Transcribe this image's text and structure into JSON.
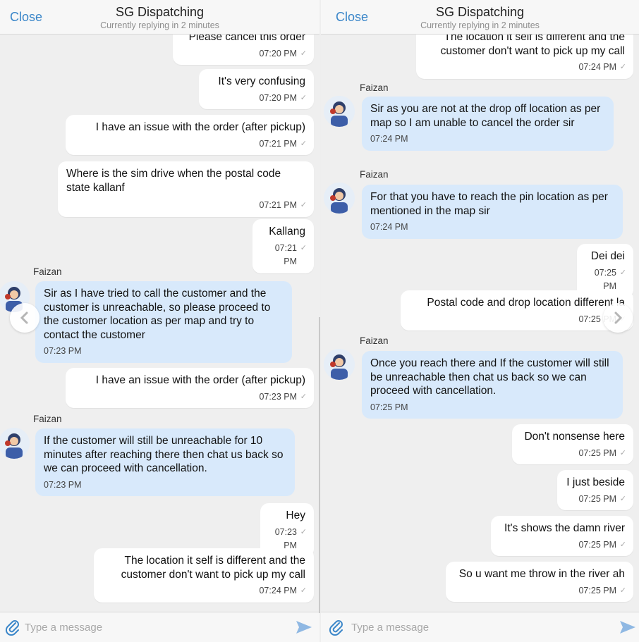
{
  "left": {
    "close_label": "Close",
    "title": "SG Dispatching",
    "subtitle": "Currently replying in 2 minutes",
    "messages": [
      {
        "text": "Please cancel this order",
        "time": "07:20 PM"
      },
      {
        "text": "It's very confusing",
        "time": "07:20 PM"
      },
      {
        "text": "I have an issue with the order (after pickup)",
        "time": "07:21 PM"
      },
      {
        "text": "Where is the sim drive when the postal code state kallanf",
        "time": "07:21 PM"
      },
      {
        "text": "Kallang",
        "time": "07:21 PM"
      },
      {
        "sender": "Faizan",
        "text": "Sir as I have tried to call the customer and the customer is unreachable, so please proceed to the customer location as per map and try to contact the customer",
        "time": "07:23 PM"
      },
      {
        "text": "I have an issue with the order (after pickup)",
        "time": "07:23 PM"
      },
      {
        "sender": "Faizan",
        "text": "If the customer will still be unreachable for 10 minutes after reaching there then chat us back so we can proceed with cancellation.",
        "time": "07:23 PM"
      },
      {
        "text": "Hey",
        "time": "07:23 PM"
      },
      {
        "text": "The location it self is different and the customer don't want to pick up my call",
        "time": "07:24 PM"
      }
    ],
    "composer_placeholder": "Type a message"
  },
  "right": {
    "close_label": "Close",
    "title": "SG Dispatching",
    "subtitle": "Currently replying in 2 minutes",
    "messages": [
      {
        "text": "The location it self is different and the customer don't want to pick up my call",
        "time": "07:24 PM"
      },
      {
        "sender": "Faizan",
        "text": "Sir as you are not at the drop off location as per map so I am unable to cancel the order sir",
        "time": "07:24 PM"
      },
      {
        "sender": "Faizan",
        "text": "For that you have to reach the pin location as per mentioned in the map sir",
        "time": "07:24 PM"
      },
      {
        "text": "Dei dei",
        "time": "07:25 PM"
      },
      {
        "text": "Postal code and drop location different la",
        "time": "07:25 PM"
      },
      {
        "sender": "Faizan",
        "text": "Once you reach there and If the customer will still be unreachable then chat us back so we can proceed with cancellation.",
        "time": "07:25 PM"
      },
      {
        "text": "Don't nonsense here",
        "time": "07:25 PM"
      },
      {
        "text": "I just beside",
        "time": "07:25 PM"
      },
      {
        "text": "It's shows the damn river",
        "time": "07:25 PM"
      },
      {
        "text": "So u want me throw in the river ah",
        "time": "07:25 PM"
      }
    ],
    "composer_placeholder": "Type a message"
  },
  "icons": {
    "attach": "paperclip-icon",
    "send": "send-icon",
    "prev": "chevron-left-icon",
    "next": "chevron-right-icon"
  },
  "colors": {
    "accent": "#3a86c9",
    "incoming_bubble": "#d8e9fb",
    "outgoing_bubble": "#ffffff",
    "send_icon": "#8fb8e3"
  }
}
